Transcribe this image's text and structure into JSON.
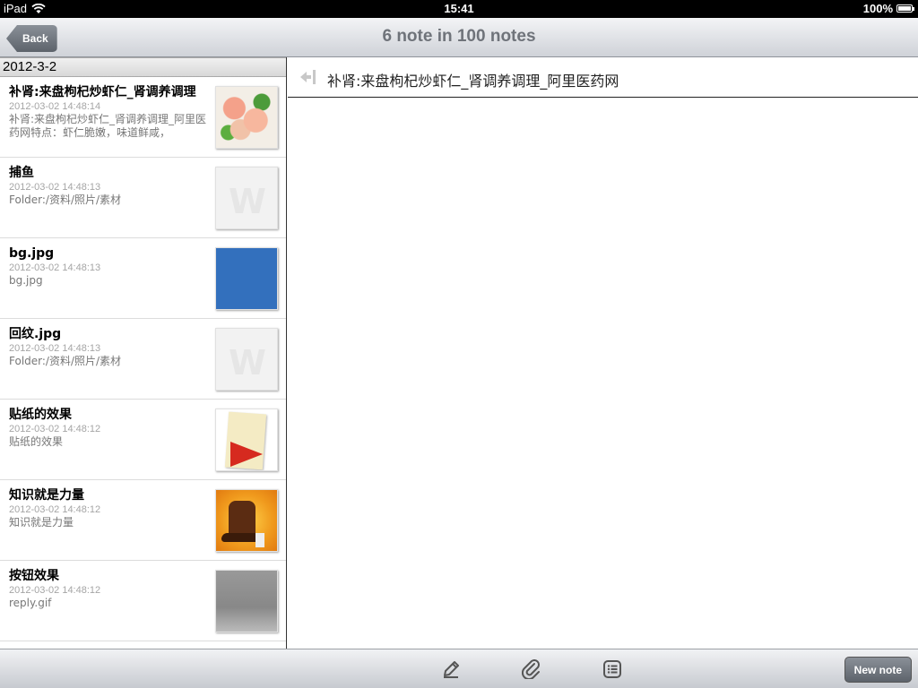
{
  "status": {
    "device": "iPad",
    "time": "15:41",
    "battery": "100%",
    "battery_level": 1.0
  },
  "nav": {
    "back_label": "Back",
    "title": "6 note in 100 notes"
  },
  "list": {
    "section": "2012-3-2",
    "items": [
      {
        "title": "补肾:来盘枸杞炒虾仁_肾调养调理",
        "date": "2012-03-02 14:48:14",
        "snippet": "补肾:来盘枸杞炒虾仁_肾调养调理_阿里医药网特点：虾仁脆嫩，味道鲜咸，",
        "thumb": "shrimp"
      },
      {
        "title": "捕鱼",
        "date": "2012-03-02 14:48:13",
        "snippet": "Folder:/资料/照片/素材",
        "thumb": "placeholder"
      },
      {
        "title": "bg.jpg",
        "date": "2012-03-02 14:48:13",
        "snippet": "bg.jpg",
        "thumb": "blue"
      },
      {
        "title": "回纹.jpg",
        "date": "2012-03-02 14:48:13",
        "snippet": "Folder:/资料/照片/素材",
        "thumb": "placeholder"
      },
      {
        "title": "贴纸的效果",
        "date": "2012-03-02 14:48:12",
        "snippet": "贴纸的效果",
        "thumb": "sticker"
      },
      {
        "title": "知识就是力量",
        "date": "2012-03-02 14:48:12",
        "snippet": "知识就是力量",
        "thumb": "shoe"
      },
      {
        "title": "按钮效果",
        "date": "2012-03-02 14:48:12",
        "snippet": "reply.gif",
        "thumb": "gray"
      }
    ]
  },
  "detail": {
    "title": "补肾:来盘枸杞炒虾仁_肾调养调理_阿里医药网"
  },
  "toolbar": {
    "icons": [
      "pencil-icon",
      "paperclip-icon",
      "list-icon"
    ],
    "new_note_label": "New note"
  }
}
